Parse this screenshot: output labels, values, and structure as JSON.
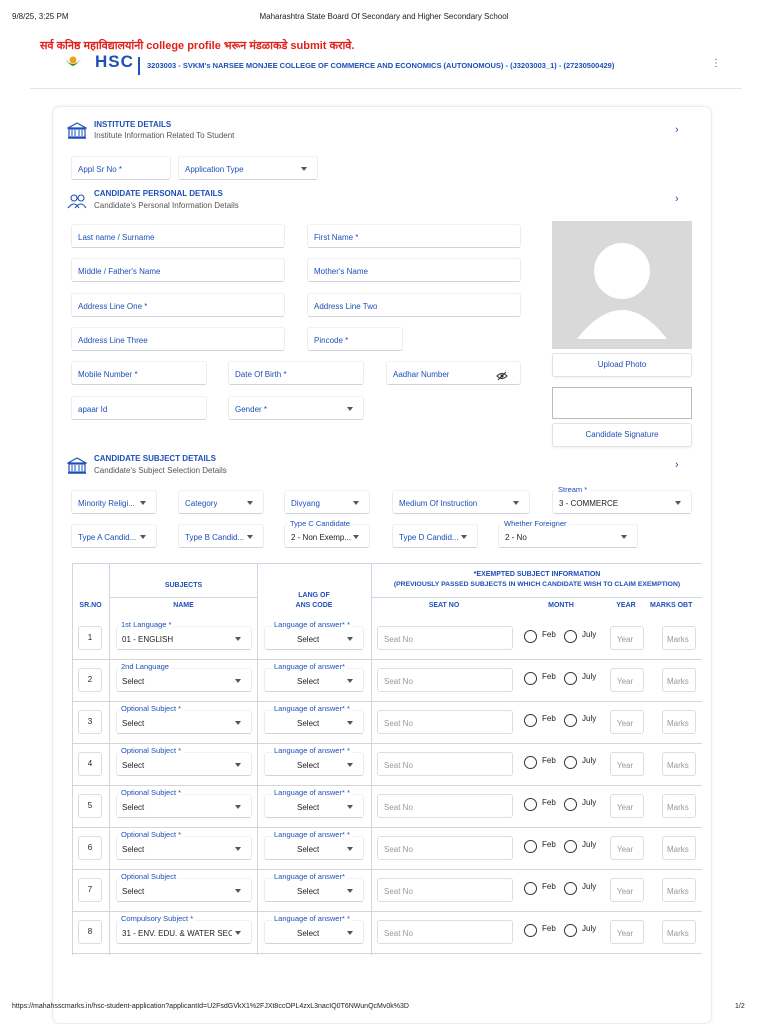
{
  "print_header": {
    "datetime": "9/8/25, 3:25 PM",
    "page_title": "Maharashtra State Board Of Secondary and Higher Secondary School"
  },
  "notice": "सर्व कनिष्ठ महाविद्यालयांनी college profile भरून मंडळाकडे submit करावे.",
  "logo_text": "HSC",
  "college_info": "3203003 - SVKM's NARSEE MONJEE COLLEGE OF COMMERCE AND ECONOMICS (AUTONOMOUS) - (J3203003_1) - (27230500429)",
  "institute": {
    "title": "INSTITUTE DETAILS",
    "subtitle": "Institute Information Related To Student",
    "appl_sr_no": "Appl Sr No *",
    "application_type": "Application Type"
  },
  "personal": {
    "title": "CANDIDATE PERSONAL DETAILS",
    "subtitle": "Candidate's Personal Information Details",
    "last_name": "Last name / Surname",
    "first_name": "First Name *",
    "middle_name": "Middle / Father's Name",
    "mother_name": "Mother's Name",
    "address1": "Address Line One *",
    "address2": "Address Line Two",
    "address3": "Address Line Three",
    "pincode": "Pincode *",
    "mobile": "Mobile Number *",
    "dob": "Date Of Birth *",
    "aadhar": "Aadhar Number",
    "apaar": "apaar Id",
    "gender": "Gender *",
    "upload_photo": "Upload Photo",
    "candidate_signature": "Candidate Signature"
  },
  "subject_details": {
    "title": "CANDIDATE SUBJECT DETAILS",
    "subtitle": "Candidate's Subject Selection Details",
    "minority": "Minority Religi...",
    "category": "Category",
    "divyang": "Divyang",
    "medium": "Medium Of Instruction",
    "stream_label": "Stream *",
    "stream_value": "3 - COMMERCE",
    "type_a": "Type A Candid...",
    "type_b": "Type B Candid...",
    "type_c_label": "Type C Candidate",
    "type_c_value": "2 - Non Exemp...",
    "type_d": "Type D Candid...",
    "foreigner_label": "Whether Foreigner",
    "foreigner_value": "2 - No"
  },
  "table": {
    "h_srno": "SR.NO",
    "h_subjects": "SUBJECTS",
    "h_name": "NAME",
    "h_lang": "LANG OF ANS CODE",
    "h_exempt_line1": "*EXEMPTED SUBJECT INFORMATION",
    "h_exempt_line2": "(PREVIOUSLY PASSED SUBJECTS IN WHICH CANDIDATE WISH TO CLAIM EXEMPTION)",
    "h_seat": "SEAT NO",
    "h_month": "MONTH",
    "h_year": "YEAR",
    "h_marks": "MARKS OBT",
    "seat_placeholder": "Seat No",
    "year_placeholder": "Year",
    "marks_placeholder": "Marks",
    "feb": "Feb",
    "july": "July",
    "rows": [
      {
        "sr": "1",
        "label": "1st Language *",
        "value": "01 - ENGLISH",
        "lang_label": "Language of answer* *",
        "lang_value": "Select"
      },
      {
        "sr": "2",
        "label": "2nd Language",
        "value": "Select",
        "lang_label": "Language of answer*",
        "lang_value": "Select"
      },
      {
        "sr": "3",
        "label": "Optional Subject *",
        "value": "Select",
        "lang_label": "Language of answer* *",
        "lang_value": "Select"
      },
      {
        "sr": "4",
        "label": "Optional Subject *",
        "value": "Select",
        "lang_label": "Language of answer* *",
        "lang_value": "Select"
      },
      {
        "sr": "5",
        "label": "Optional Subject *",
        "value": "Select",
        "lang_label": "Language of answer* *",
        "lang_value": "Select"
      },
      {
        "sr": "6",
        "label": "Optional Subject *",
        "value": "Select",
        "lang_label": "Language of answer* *",
        "lang_value": "Select"
      },
      {
        "sr": "7",
        "label": "Optional Subject",
        "value": "Select",
        "lang_label": "Language of answer*",
        "lang_value": "Select"
      },
      {
        "sr": "8",
        "label": "Compulsory Subject *",
        "value": "31 - ENV. EDU. & WATER SEC...",
        "lang_label": "Language of answer* *",
        "lang_value": "Select"
      }
    ]
  },
  "footer": {
    "url": "https://mahahsscmarks.in/hsc-student-application?applicantId=U2FsdGVkX1%2FJXt8ccOPL4zxL3nacIQ0T6NWunQcMv0k%3D",
    "page": "1/2"
  },
  "colors": {
    "accent": "#1d4fb8",
    "notice": "#e0201c"
  }
}
